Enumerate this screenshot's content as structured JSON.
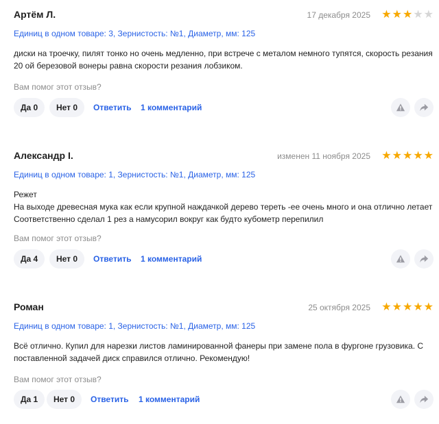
{
  "helpful_prompt": "Вам помог этот отзыв?",
  "colors": {
    "accent": "#2962e6",
    "star": "#f7a800",
    "star_empty": "#d6d6d6"
  },
  "reviews": [
    {
      "author": "Артём Л.",
      "date": "17 декабря 2025",
      "rating": 3,
      "variant": "Единиц в одном товаре: 3, Зернистость: №1, Диаметр, мм: 125",
      "text": "диски на троечку, пилят тонко но очень медленно, при встрече с металом немного тупятся, скорость резания 20 ой березовой вонеры равна скорости резания лобзиком.",
      "yes_label": "Да 0",
      "no_label": "Нет 0",
      "reply_label": "Ответить",
      "comments_label": "1 комментарий"
    },
    {
      "author": "Александр I.",
      "date": "изменен 11 ноября 2025",
      "rating": 5,
      "variant": "Единиц в одном товаре: 1, Зернистость: №1, Диаметр, мм: 125",
      "text": "Режет\nНа выходе древесная мука как если крупной наждачкой дерево тереть -ее очень много и она отлично летает\nСоответственно сделал 1 рез а намусорил вокруг как будто кубометр перепилил",
      "yes_label": "Да 4",
      "no_label": "Нет 0",
      "reply_label": "Ответить",
      "comments_label": "1 комментарий"
    },
    {
      "author": "Роман",
      "date": "25 октября 2025",
      "rating": 5,
      "variant": "Единиц в одном товаре: 1, Зернистость: №1, Диаметр, мм: 125",
      "text": "Всё отлично. Купил для нарезки листов ламинированной фанеры при замене пола в фургоне грузовика. С поставленной задачей диск справился отлично. Рекомендую!",
      "yes_label": "Да 1",
      "no_label": "Нет 0",
      "reply_label": "Ответить",
      "comments_label": "1 комментарий"
    }
  ]
}
